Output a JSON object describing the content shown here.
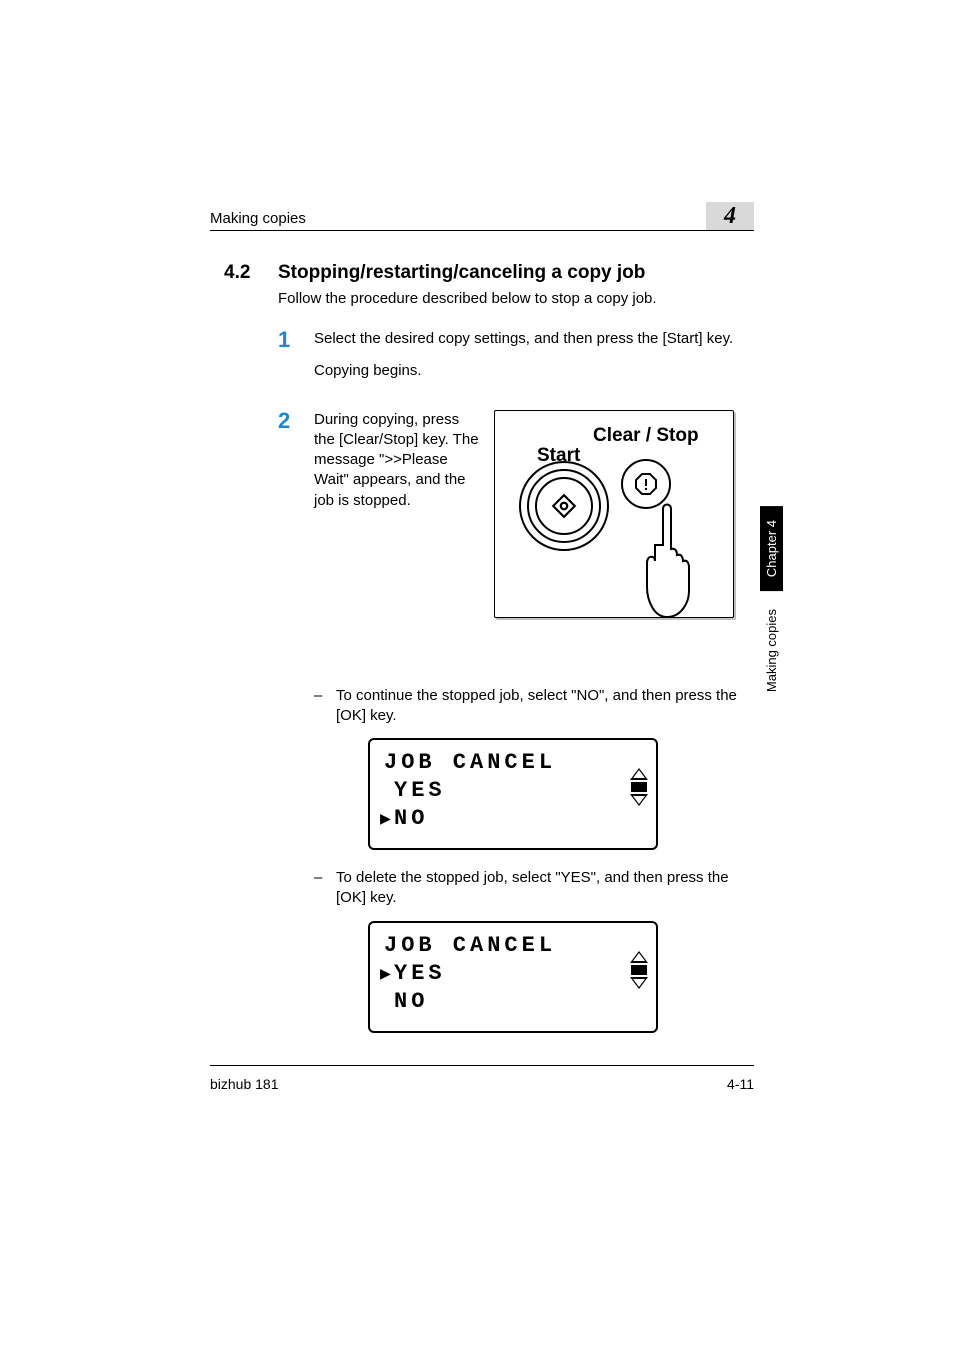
{
  "header": {
    "title": "Making copies"
  },
  "chapter_badge": "4",
  "section": {
    "number": "4.2",
    "title": "Stopping/restarting/canceling a copy job"
  },
  "intro": "Follow the procedure described below to stop a copy job.",
  "steps": {
    "s1": {
      "num": "1",
      "line1": "Select the desired copy settings, and then press the [Start] key.",
      "line2": "Copying begins."
    },
    "s2": {
      "num": "2",
      "text": "During copying, press the [Clear/Stop] key. The message \">>Please Wait\" appears, and the job is stopped."
    }
  },
  "panel": {
    "clear_stop": "Clear / Stop",
    "start": "Start"
  },
  "bullets": {
    "b1": "To continue the stopped job, select \"NO\", and then press the [OK] key.",
    "b2": "To delete the stopped job, select \"YES\", and then press the [OK] key."
  },
  "dash": "–",
  "lcd1": {
    "l1": "JOB CANCEL",
    "l2": "YES",
    "l3": "NO",
    "cursor_row": 3
  },
  "lcd2": {
    "l1": "JOB CANCEL",
    "l2": "YES",
    "l3": "NO",
    "cursor_row": 2
  },
  "pointer": "▶",
  "sidetab": {
    "black": "Chapter 4",
    "white": "Making copies"
  },
  "footer": {
    "left": "bizhub 181",
    "right": "4-11"
  }
}
